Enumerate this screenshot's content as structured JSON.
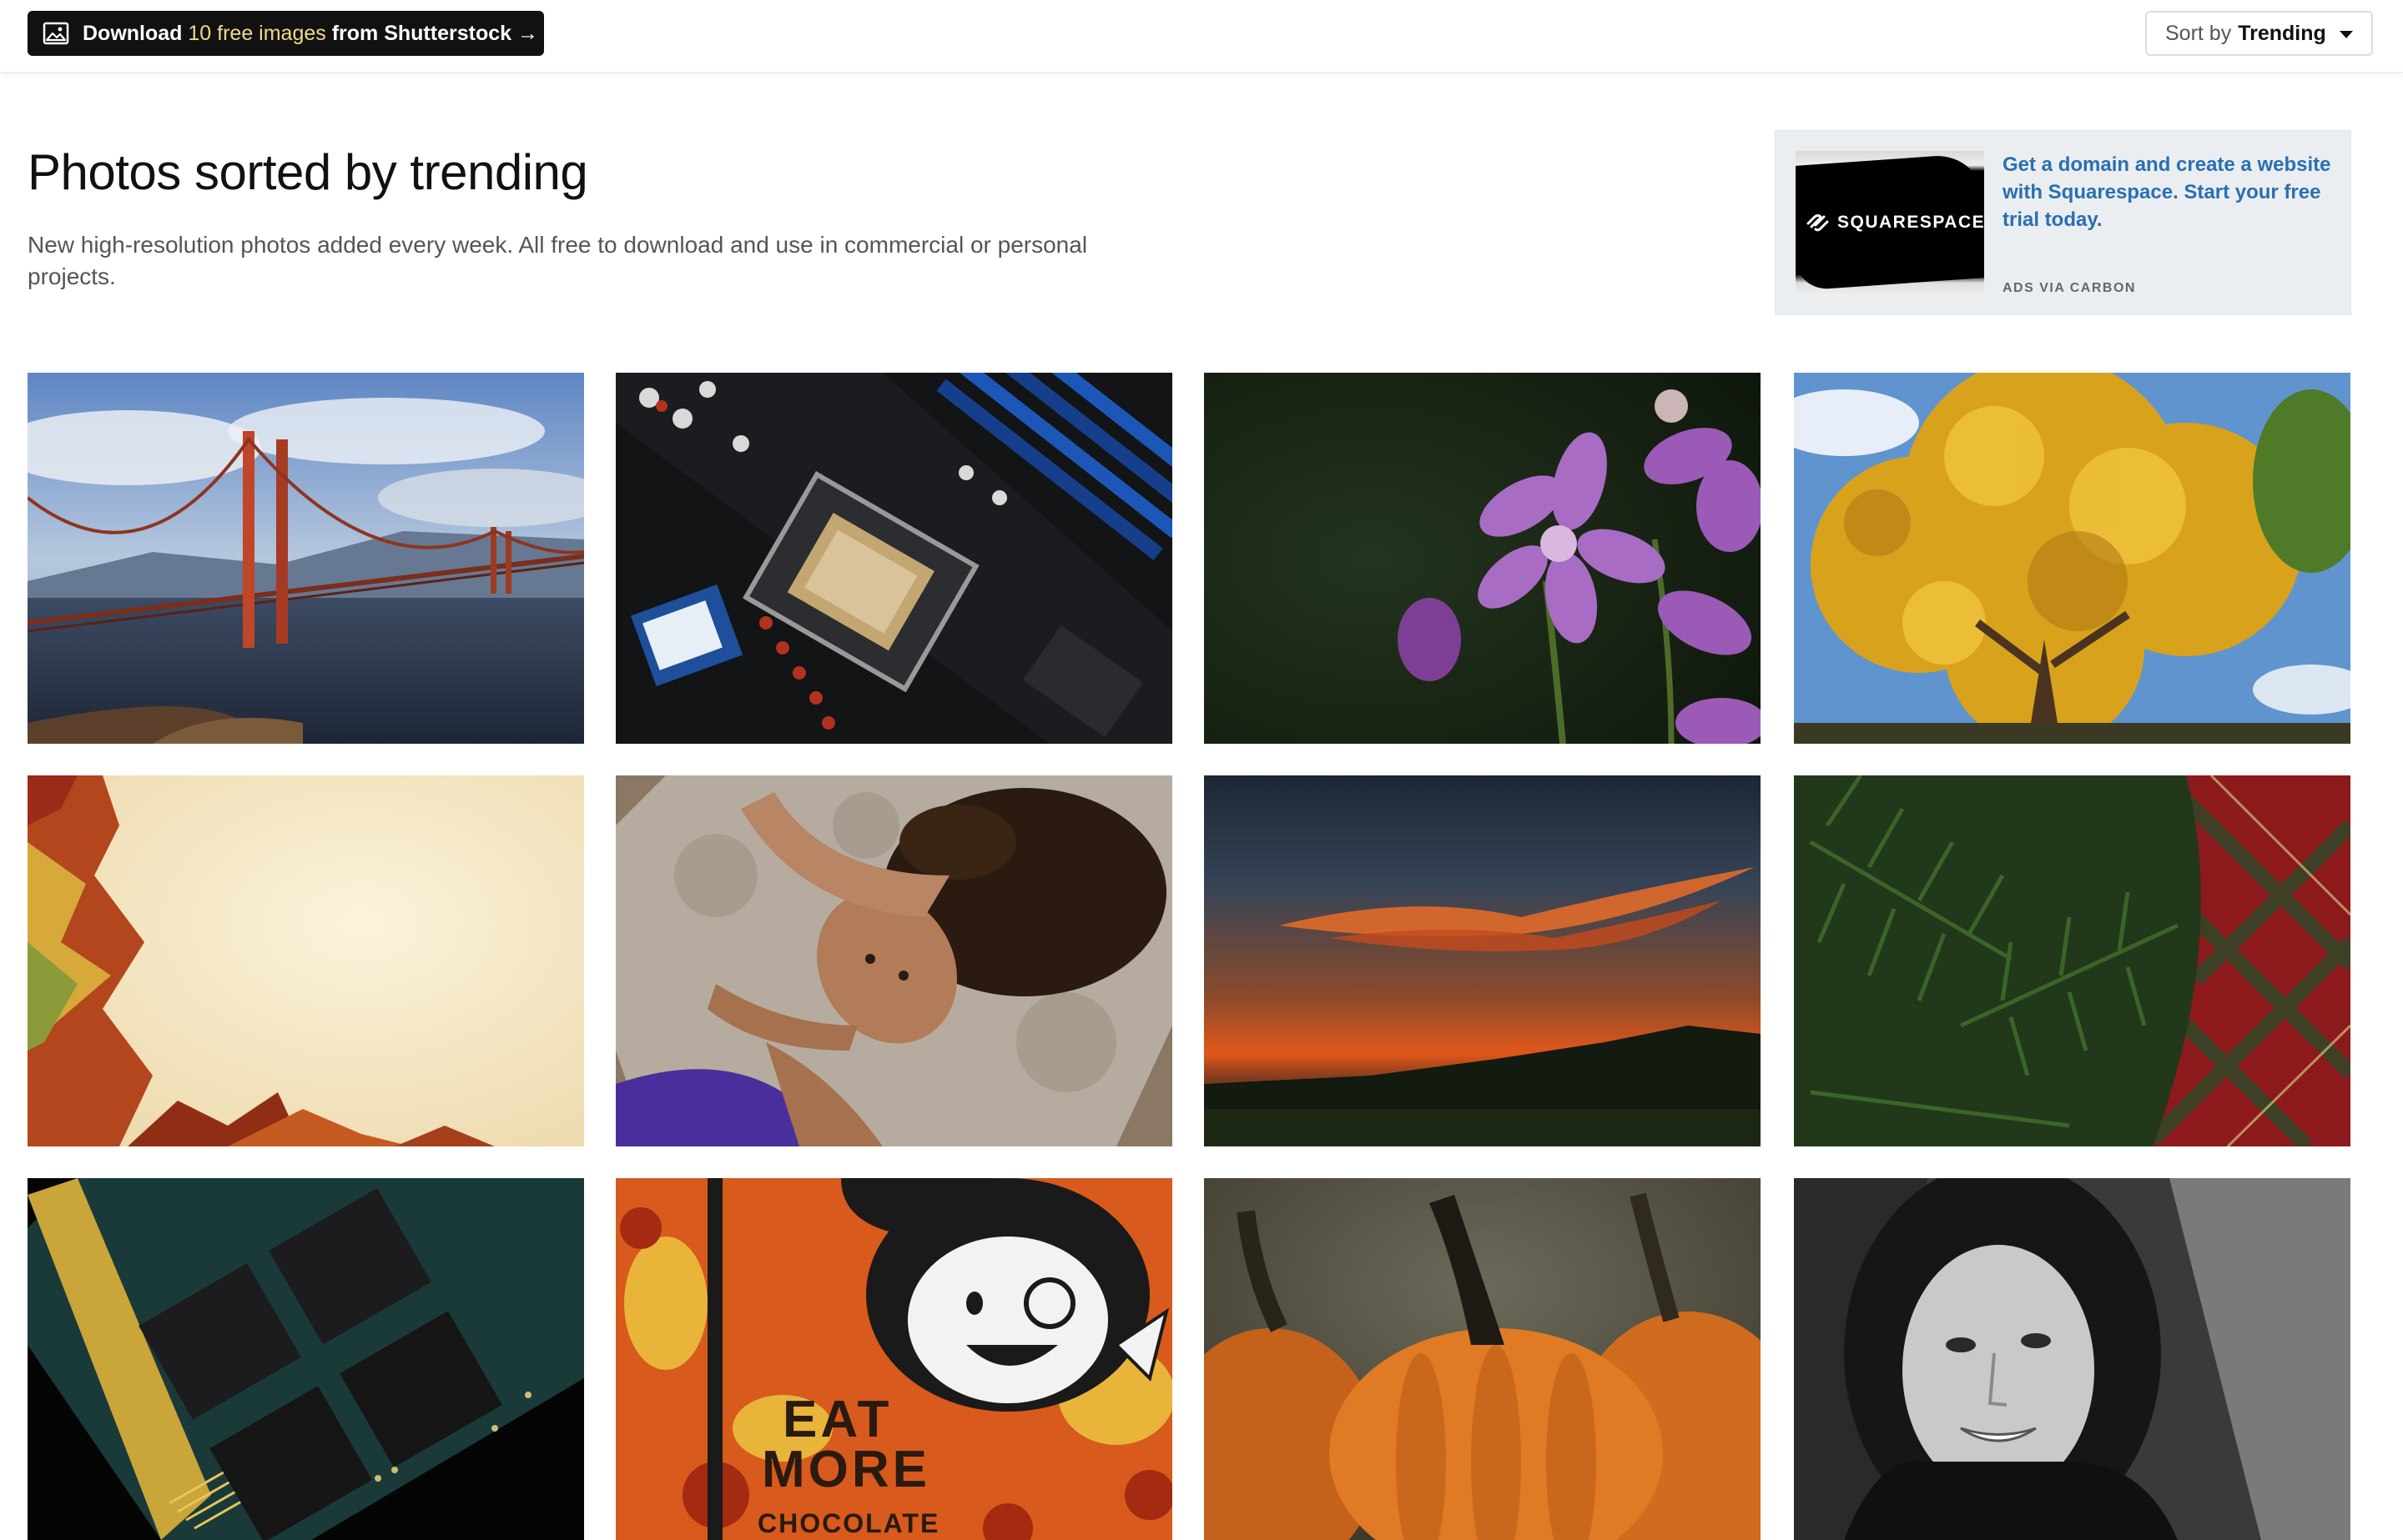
{
  "topbar": {
    "shutterstock_prefix": "Download ",
    "shutterstock_highlight": "10 free images",
    "shutterstock_suffix": " from Shutterstock →",
    "sort_prefix": "Sort by",
    "sort_value": "Trending"
  },
  "header": {
    "title": "Photos sorted by trending",
    "subtitle": "New high-resolution photos added every week. All free to download and use in commercial or personal projects."
  },
  "ad": {
    "brand": "SQUARESPACE",
    "text": "Get a domain and create a website with Squarespace. Start your free trial today.",
    "via": "ADS VIA CARBON"
  },
  "photos": [
    {
      "icon": "golden-gate-bridge-photo"
    },
    {
      "icon": "motherboard-cpu-photo"
    },
    {
      "icon": "purple-flower-photo"
    },
    {
      "icon": "autumn-tree-photo"
    },
    {
      "icon": "autumn-leaves-frame-photo"
    },
    {
      "icon": "woman-lying-on-rock-photo"
    },
    {
      "icon": "sunset-sky-photo"
    },
    {
      "icon": "pine-and-plaid-photo"
    },
    {
      "icon": "memory-chip-photo"
    },
    {
      "icon": "eat-more-chocolate-mural-photo"
    },
    {
      "icon": "pumpkins-photo"
    },
    {
      "icon": "woman-portrait-bw-photo"
    }
  ],
  "mural_text": {
    "line1": "EAT",
    "line2": "MORE",
    "line3": "CHOCOLATE"
  }
}
